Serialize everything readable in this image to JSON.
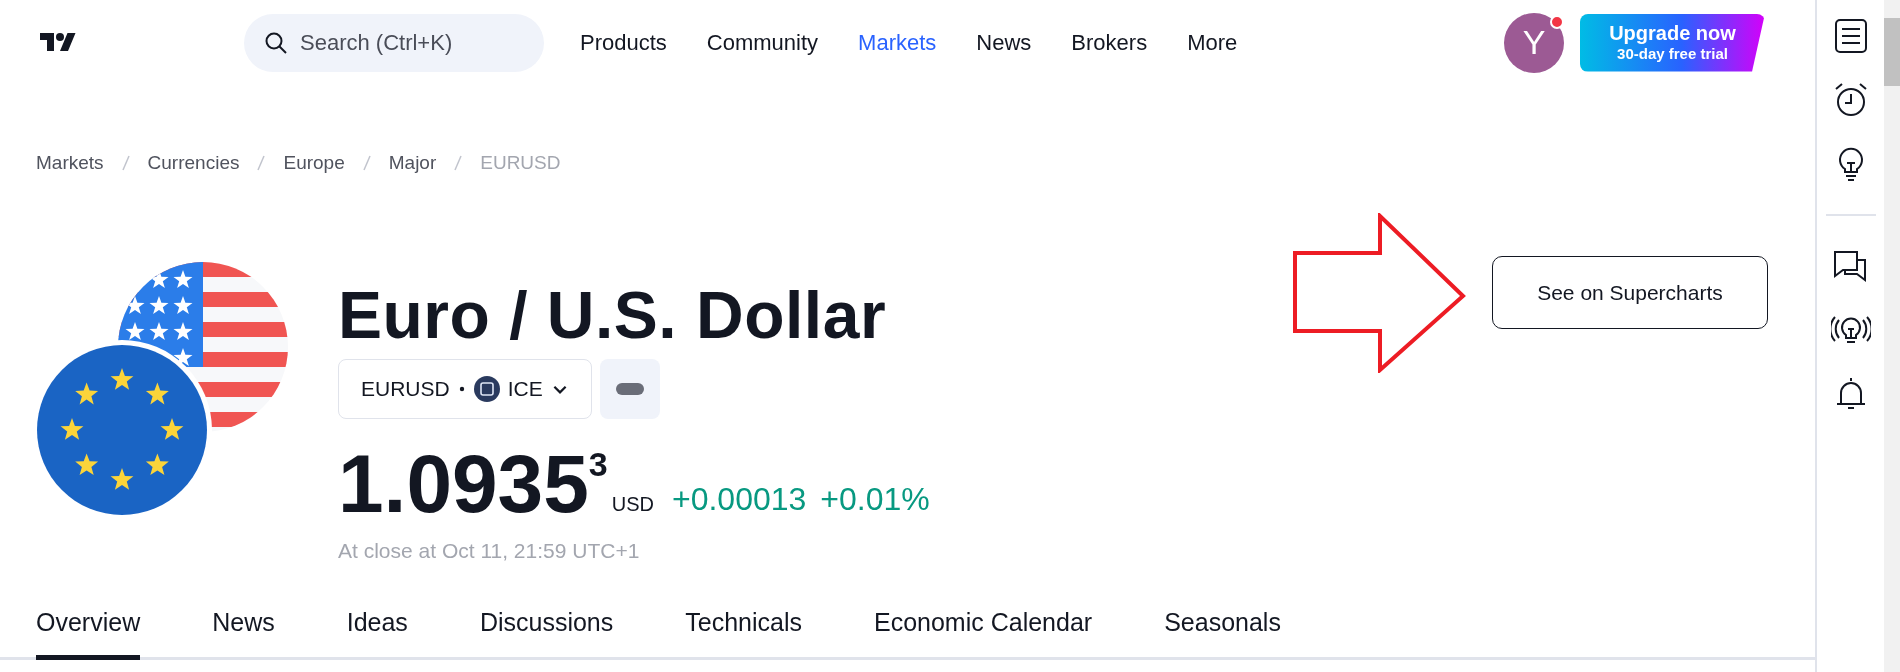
{
  "header": {
    "search": {
      "placeholder": "Search (Ctrl+K)"
    },
    "nav": [
      {
        "label": "Products",
        "selected": false
      },
      {
        "label": "Community",
        "selected": false
      },
      {
        "label": "Markets",
        "selected": true
      },
      {
        "label": "News",
        "selected": false
      },
      {
        "label": "Brokers",
        "selected": false
      },
      {
        "label": "More",
        "selected": false
      }
    ],
    "avatar": {
      "initial": "Y",
      "notification": true
    },
    "upgrade": {
      "title": "Upgrade now",
      "subtitle": "30-day free trial"
    }
  },
  "breadcrumbs": [
    {
      "label": "Markets",
      "current": false
    },
    {
      "label": "Currencies",
      "current": false
    },
    {
      "label": "Europe",
      "current": false
    },
    {
      "label": "Major",
      "current": false
    },
    {
      "label": "EURUSD",
      "current": true
    }
  ],
  "symbol": {
    "title": "Euro / U.S. Dollar",
    "ticker": "EURUSD",
    "exchange": "ICE"
  },
  "price": {
    "value": "1.0935",
    "extra_digit": "3",
    "currency": "USD",
    "change": "+0.00013",
    "change_percent": "+0.01%",
    "change_positive": true,
    "status": "At close at Oct 11, 21:59 UTC+1"
  },
  "supercharts_button": "See on Supercharts",
  "tabs": [
    {
      "label": "Overview",
      "selected": true
    },
    {
      "label": "News",
      "selected": false
    },
    {
      "label": "Ideas",
      "selected": false
    },
    {
      "label": "Discussions",
      "selected": false
    },
    {
      "label": "Technicals",
      "selected": false
    },
    {
      "label": "Economic Calendar",
      "selected": false
    },
    {
      "label": "Seasonals",
      "selected": false
    }
  ],
  "sidebar": {
    "tools": [
      {
        "kind": "watchlist"
      },
      {
        "kind": "alerts"
      },
      {
        "kind": "ideas"
      },
      {
        "kind": "divider"
      },
      {
        "kind": "chats"
      },
      {
        "kind": "streams"
      },
      {
        "kind": "notifications"
      }
    ]
  }
}
